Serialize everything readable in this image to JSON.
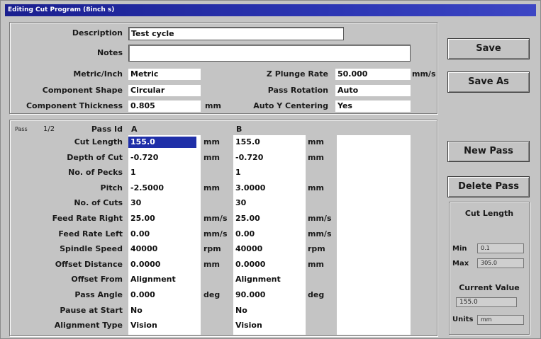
{
  "window": {
    "title": "Editing Cut Program (8inch s)"
  },
  "header": {
    "description_label": "Description",
    "description_value": "Test cycle",
    "notes_label": "Notes",
    "notes_value": "",
    "metric_label": "Metric/Inch",
    "metric_value": "Metric",
    "shape_label": "Component Shape",
    "shape_value": "Circular",
    "thickness_label": "Component Thickness",
    "thickness_value": "0.805",
    "thickness_unit": "mm",
    "plunge_label": "Z Plunge Rate",
    "plunge_value": "50.000",
    "plunge_unit": "mm/s",
    "rotation_label": "Pass Rotation",
    "rotation_value": "Auto",
    "ycenter_label": "Auto Y Centering",
    "ycenter_value": "Yes"
  },
  "passes": {
    "pass_label": "Pass",
    "pass_count": "1/2",
    "id_label": "Pass Id",
    "rows": [
      {
        "label": "Cut Length",
        "a": "155.0",
        "ua": "mm",
        "b": "155.0",
        "ub": "mm"
      },
      {
        "label": "Depth of Cut",
        "a": "-0.720",
        "ua": "mm",
        "b": "-0.720",
        "ub": "mm"
      },
      {
        "label": "No. of Pecks",
        "a": "1",
        "ua": "",
        "b": "1",
        "ub": ""
      },
      {
        "label": "Pitch",
        "a": "-2.5000",
        "ua": "mm",
        "b": "3.0000",
        "ub": "mm"
      },
      {
        "label": "No. of Cuts",
        "a": "30",
        "ua": "",
        "b": "30",
        "ub": ""
      },
      {
        "label": "Feed Rate Right",
        "a": "25.00",
        "ua": "mm/s",
        "b": "25.00",
        "ub": "mm/s"
      },
      {
        "label": "Feed Rate Left",
        "a": "0.00",
        "ua": "mm/s",
        "b": "0.00",
        "ub": "mm/s"
      },
      {
        "label": "Spindle Speed",
        "a": "40000",
        "ua": "rpm",
        "b": "40000",
        "ub": "rpm"
      },
      {
        "label": "Offset Distance",
        "a": "0.0000",
        "ua": "mm",
        "b": "0.0000",
        "ub": "mm"
      },
      {
        "label": "Offset From",
        "a": "Alignment",
        "ua": "",
        "b": "Alignment",
        "ub": ""
      },
      {
        "label": "Pass Angle",
        "a": "0.000",
        "ua": "deg",
        "b": "90.000",
        "ub": "deg"
      },
      {
        "label": "Pause at Start",
        "a": "No",
        "ua": "",
        "b": "No",
        "ub": ""
      },
      {
        "label": "Alignment Type",
        "a": "Vision",
        "ua": "",
        "b": "Vision",
        "ub": ""
      }
    ],
    "id_a": "A",
    "id_b": "B"
  },
  "buttons": {
    "save": "Save",
    "save_as": "Save As",
    "new_pass": "New Pass",
    "delete_pass": "Delete Pass"
  },
  "cut_length_panel": {
    "title": "Cut Length",
    "min_label": "Min",
    "min_value": "0.1",
    "max_label": "Max",
    "max_value": "305.0",
    "current_label": "Current Value",
    "current_value": "155.0",
    "units_label": "Units",
    "units_value": "mm"
  }
}
